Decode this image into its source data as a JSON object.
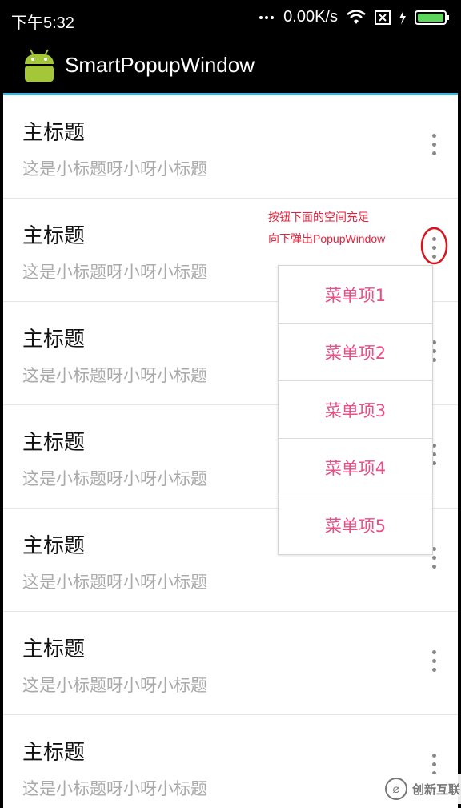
{
  "status_bar": {
    "time": "下午5:32",
    "speed": "0.00K/s",
    "icons": [
      "more-dots-icon",
      "wifi-icon",
      "sim-close-icon",
      "charging-bolt-icon",
      "battery-icon"
    ]
  },
  "app_bar": {
    "title": "SmartPopupWindow",
    "icon": "android-icon",
    "accent_color": "#33b5e5"
  },
  "list": {
    "items": [
      {
        "title": "主标题",
        "subtitle": "这是小标题呀小呀小标题"
      },
      {
        "title": "主标题",
        "subtitle": "这是小标题呀小呀小标题"
      },
      {
        "title": "主标题",
        "subtitle": "这是小标题呀小呀小标题"
      },
      {
        "title": "主标题",
        "subtitle": "这是小标题呀小呀小标题"
      },
      {
        "title": "主标题",
        "subtitle": "这是小标题呀小呀小标题"
      },
      {
        "title": "主标题",
        "subtitle": "这是小标题呀小呀小标题"
      },
      {
        "title": "主标题",
        "subtitle": "这是小标题呀小呀小标题"
      }
    ]
  },
  "annotation": {
    "line1": "按钮下面的空间充足",
    "line2": "向下弹出PopupWindow",
    "color": "#e8213b"
  },
  "popup_menu": {
    "items": [
      "菜单项1",
      "菜单项2",
      "菜单项3",
      "菜单项4",
      "菜单项5"
    ],
    "text_color": "#e84f86"
  },
  "watermark": {
    "text": "创新互联",
    "icon": "watermark-logo-icon"
  }
}
